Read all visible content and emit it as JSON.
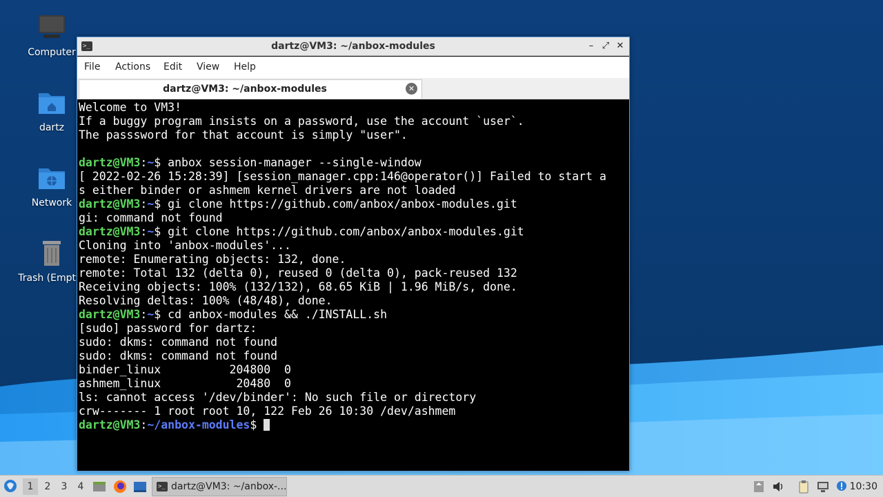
{
  "desktop": {
    "icons": [
      {
        "label": "Computer",
        "icon": "computer-icon"
      },
      {
        "label": "dartz",
        "icon": "home-folder-icon"
      },
      {
        "label": "Network",
        "icon": "network-folder-icon"
      },
      {
        "label": "Trash (Empty)",
        "icon": "trash-icon"
      }
    ]
  },
  "window": {
    "title": "dartz@VM3: ~/anbox-modules",
    "controls": {
      "minimize": "–",
      "maximize": "⤢",
      "close": "✕"
    },
    "menu": [
      "File",
      "Actions",
      "Edit",
      "View",
      "Help"
    ],
    "tab": {
      "label": "dartz@VM3: ~/anbox-modules",
      "close": "✕"
    }
  },
  "terminal": {
    "lines": [
      {
        "type": "out",
        "text": "Welcome to VM3!"
      },
      {
        "type": "out",
        "text": "If a buggy program insists on a password, use the account `user`."
      },
      {
        "type": "out",
        "text": "The passsword for that account is simply \"user\"."
      },
      {
        "type": "out",
        "text": ""
      },
      {
        "type": "prompt",
        "user": "dartz@VM3",
        "path": "~",
        "cmd": " anbox session-manager --single-window"
      },
      {
        "type": "out",
        "text": "[ 2022-02-26 15:28:39] [session_manager.cpp:146@operator()] Failed to start a"
      },
      {
        "type": "out",
        "text": "s either binder or ashmem kernel drivers are not loaded"
      },
      {
        "type": "prompt",
        "user": "dartz@VM3",
        "path": "~",
        "cmd": " gi clone https://github.com/anbox/anbox-modules.git"
      },
      {
        "type": "out",
        "text": "gi: command not found"
      },
      {
        "type": "prompt",
        "user": "dartz@VM3",
        "path": "~",
        "cmd": " git clone https://github.com/anbox/anbox-modules.git"
      },
      {
        "type": "out",
        "text": "Cloning into 'anbox-modules'..."
      },
      {
        "type": "out",
        "text": "remote: Enumerating objects: 132, done."
      },
      {
        "type": "out",
        "text": "remote: Total 132 (delta 0), reused 0 (delta 0), pack-reused 132"
      },
      {
        "type": "out",
        "text": "Receiving objects: 100% (132/132), 68.65 KiB | 1.96 MiB/s, done."
      },
      {
        "type": "out",
        "text": "Resolving deltas: 100% (48/48), done."
      },
      {
        "type": "prompt",
        "user": "dartz@VM3",
        "path": "~",
        "cmd": " cd anbox-modules && ./INSTALL.sh"
      },
      {
        "type": "out",
        "text": "[sudo] password for dartz:"
      },
      {
        "type": "out",
        "text": "sudo: dkms: command not found"
      },
      {
        "type": "out",
        "text": "sudo: dkms: command not found"
      },
      {
        "type": "out",
        "text": "binder_linux          204800  0"
      },
      {
        "type": "out",
        "text": "ashmem_linux           20480  0"
      },
      {
        "type": "out",
        "text": "ls: cannot access '/dev/binder': No such file or directory"
      },
      {
        "type": "out",
        "text": "crw------- 1 root root 10, 122 Feb 26 10:30 /dev/ashmem"
      },
      {
        "type": "prompt",
        "user": "dartz@VM3",
        "path": "~/anbox-modules",
        "cmd": " ",
        "cursor": true
      }
    ]
  },
  "taskbar": {
    "workspaces": [
      "1",
      "2",
      "3",
      "4"
    ],
    "active_workspace": "1",
    "launchers": [
      "file-manager-icon",
      "firefox-icon",
      "desktop-icon"
    ],
    "task_button": {
      "label": "dartz@VM3: ~/anbox-..."
    },
    "tray": [
      "notes-icon",
      "volume-icon",
      "clipboard-icon",
      "network-icon",
      "update-icon"
    ],
    "clock": "10:30"
  }
}
